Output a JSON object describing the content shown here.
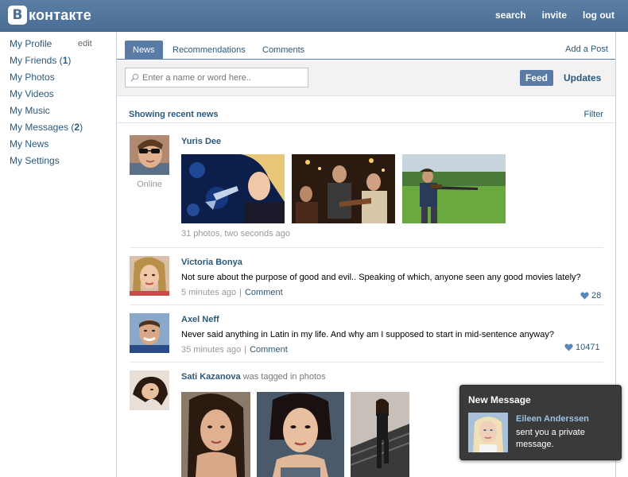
{
  "app": {
    "logo_letter": "В",
    "logo_text": "контакте"
  },
  "top_nav": {
    "search": "search",
    "invite": "invite",
    "logout": "log out"
  },
  "left_menu": {
    "items": [
      {
        "label": "My Profile",
        "suffix": "edit"
      },
      {
        "label": "My Friends",
        "count": "1"
      },
      {
        "label": "My Photos"
      },
      {
        "label": "My Videos"
      },
      {
        "label": "My Music"
      },
      {
        "label": "My Messages",
        "count": "2"
      },
      {
        "label": "My News"
      },
      {
        "label": "My Settings"
      }
    ]
  },
  "tabs": {
    "news": "News",
    "recommendations": "Recommendations",
    "comments": "Comments",
    "add_post": "Add a Post"
  },
  "search": {
    "placeholder": "Enter a name or word here..",
    "feed": "Feed",
    "updates": "Updates"
  },
  "feed": {
    "heading": "Showing recent news",
    "filter": "Filter",
    "posts": [
      {
        "author": "Yuris Dee",
        "status": "Online",
        "meta": "31 photos, two seconds ago"
      },
      {
        "author": "Victoria Bonya",
        "text": "Not sure about the purpose of good and evil.. Speaking of which, anyone seen any good movies lately?",
        "time": "5 minutes ago",
        "comment": "Comment",
        "likes": "28"
      },
      {
        "author": "Axel Neff",
        "text": "Never said anything in Latin in my life. And why am I supposed to start in mid-sentence anyway?",
        "time": "35 minutes ago",
        "comment": "Comment",
        "likes": "10471"
      },
      {
        "author": "Sati Kazanova",
        "suffix": "was tagged in photos"
      }
    ]
  },
  "notification": {
    "title": "New Message",
    "sender": "Eileen Anderssen",
    "text": "sent you a private message."
  },
  "colors": {
    "header": "#4a6d95",
    "link": "#2b587a",
    "accent": "#597ba5",
    "popup_bg": "#3a3a3a"
  }
}
